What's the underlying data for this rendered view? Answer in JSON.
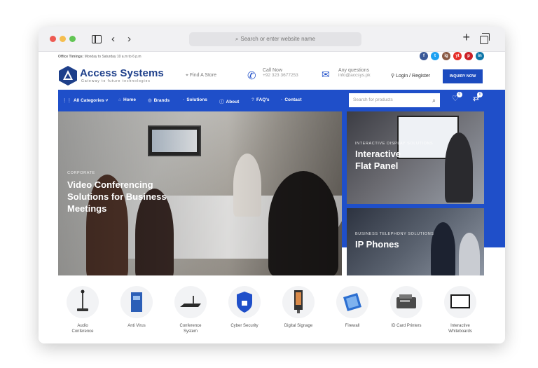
{
  "browser": {
    "address_placeholder": "Search or enter website name"
  },
  "topbar": {
    "timings_label": "Office Timings:",
    "timings_value": "Monday to Saturday 10 a.m to 6 p.m",
    "social": [
      "f",
      "t",
      "ig",
      "yt",
      "p",
      "in"
    ]
  },
  "header": {
    "logo_name": "Access Systems",
    "logo_tagline": "Gateway to future technologies",
    "find_store": "Find A Store",
    "call_label": "Call Now",
    "call_number": "+92 323 3677253",
    "email_label": "Any questions",
    "email_value": "info@accsys.pk",
    "login": "Login / Register",
    "inquiry": "INQUIRY NOW"
  },
  "nav": {
    "items": [
      "All Categories",
      "Home",
      "Brands",
      "Solutions",
      "About",
      "FAQ's",
      "Contact"
    ],
    "search_placeholder": "Search for products",
    "wishlist_count": "0",
    "compare_count": "0"
  },
  "hero": {
    "main_tag": "CORPORATE",
    "main_title_1": "Video Conferencing",
    "main_title_2": "Solutions for Business",
    "main_title_3": "Meetings",
    "side1_tag": "INTERACTIVE DISPLAY SOLUTIONS",
    "side1_title_1": "Interactive",
    "side1_title_2": "Flat Panel",
    "side2_tag": "BUSINESS TELEPHONY SOLUTIONS",
    "side2_title": "IP Phones"
  },
  "categories": [
    {
      "label_1": "Audio",
      "label_2": "Conference"
    },
    {
      "label_1": "Anti Virus",
      "label_2": ""
    },
    {
      "label_1": "Conference",
      "label_2": "System"
    },
    {
      "label_1": "Cyber Security",
      "label_2": ""
    },
    {
      "label_1": "Digital Signage",
      "label_2": ""
    },
    {
      "label_1": "Firewall",
      "label_2": ""
    },
    {
      "label_1": "ID Card Printers",
      "label_2": ""
    },
    {
      "label_1": "Interactive",
      "label_2": "Whiteboards"
    }
  ]
}
